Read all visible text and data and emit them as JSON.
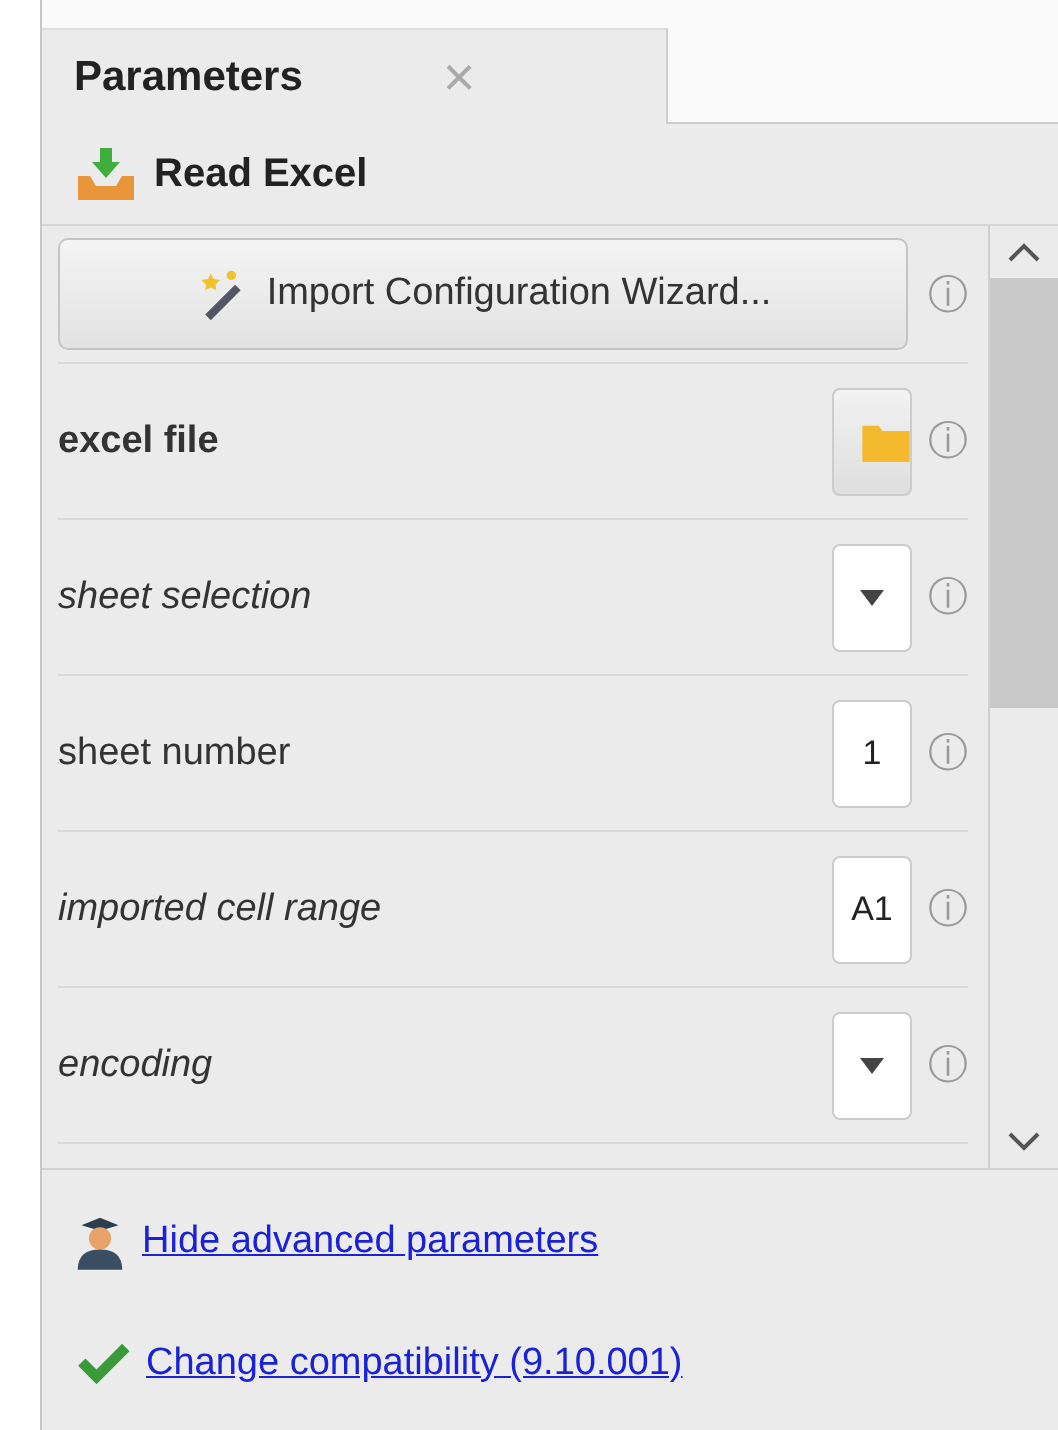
{
  "tab": {
    "label": "Parameters",
    "close": "×",
    "selected": true
  },
  "operator": {
    "title": "Read Excel"
  },
  "wizard_button": {
    "label": "Import Configuration Wizard...",
    "info": "ⓘ"
  },
  "parameters": [
    {
      "label": "excel file",
      "kind": "file",
      "info": "ⓘ"
    },
    {
      "label": "sheet selection",
      "kind": "dropdown",
      "info": "ⓘ"
    },
    {
      "label": "sheet number",
      "kind": "number",
      "value": "1",
      "info": "ⓘ"
    },
    {
      "label": "imported cell range",
      "kind": "text",
      "value": "A1",
      "info": "ⓘ"
    },
    {
      "label": "encoding",
      "kind": "dropdown",
      "info": "ⓘ"
    }
  ],
  "footer_links": [
    {
      "label": "Hide advanced parameters"
    },
    {
      "label": "Change compatibility (9.10.001)"
    }
  ]
}
